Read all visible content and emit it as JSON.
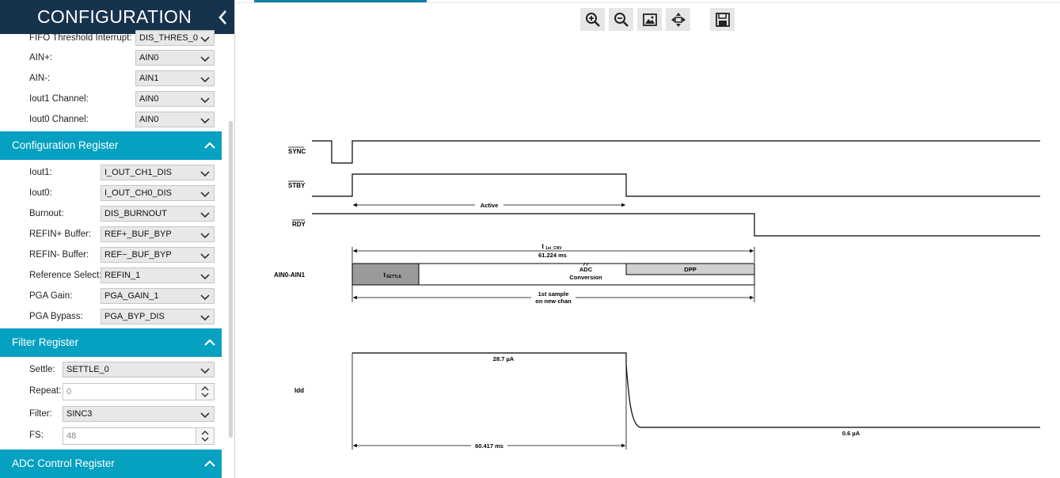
{
  "sidebar": {
    "title": "CONFIGURATION",
    "fields_top": [
      {
        "label": "FIFO Threshold Interrupt:",
        "value": "DIS_THRES_0"
      },
      {
        "label": "AIN+:",
        "value": "AIN0"
      },
      {
        "label": "AIN-:",
        "value": "AIN1"
      },
      {
        "label": "Iout1 Channel:",
        "value": "AIN0"
      },
      {
        "label": "Iout0 Channel:",
        "value": "AIN0"
      }
    ],
    "sections": [
      {
        "title": "Configuration Register"
      },
      {
        "title": "Filter Register"
      },
      {
        "title": "ADC Control Register"
      }
    ],
    "config_fields": [
      {
        "label": "Iout1:",
        "value": "I_OUT_CH1_DIS"
      },
      {
        "label": "Iout0:",
        "value": "I_OUT_CH0_DIS"
      },
      {
        "label": "Burnout:",
        "value": "DIS_BURNOUT"
      },
      {
        "label": "REFIN+ Buffer:",
        "value": "REF+_BUF_BYP"
      },
      {
        "label": "REFIN- Buffer:",
        "value": "REF−_BUF_BYP"
      },
      {
        "label": "Reference Select:",
        "value": "REFIN_1"
      },
      {
        "label": "PGA Gain:",
        "value": "PGA_GAIN_1"
      },
      {
        "label": "PGA Bypass:",
        "value": "PGA_BYP_DIS"
      }
    ],
    "filter_fields": [
      {
        "label": "Settle:",
        "value": "SETTLE_0"
      },
      {
        "label": "Repeat:",
        "value": "0"
      },
      {
        "label": "Filter:",
        "value": "SINC3"
      },
      {
        "label": "FS:",
        "value": "48"
      }
    ]
  },
  "toolbar": {
    "icons": [
      "zoom-in-icon",
      "zoom-out-icon",
      "fit-image-icon",
      "pan-move-icon",
      "save-icon"
    ]
  },
  "diagram": {
    "signals": {
      "sync": "SYNC",
      "stby": "STBY",
      "rdy": "RDY",
      "ain": "AIN0-AIN1",
      "idd": "Idd"
    },
    "labels": {
      "active": "Active",
      "t1st_main": "t",
      "t1st_sub": "1st_CNV",
      "t1st_value": "61.224 ms",
      "tsettle_main": "t",
      "tsettle_sub": "SETTLE",
      "adc_line1": "ADC",
      "adc_line2": "Conversion",
      "dpp": "DPP",
      "first_sample_line1": "1st sample",
      "first_sample_line2": "on new chan",
      "idd_high": "28.7 µA",
      "idd_low": "0.6 µA",
      "duration": "60.417 ms"
    }
  }
}
